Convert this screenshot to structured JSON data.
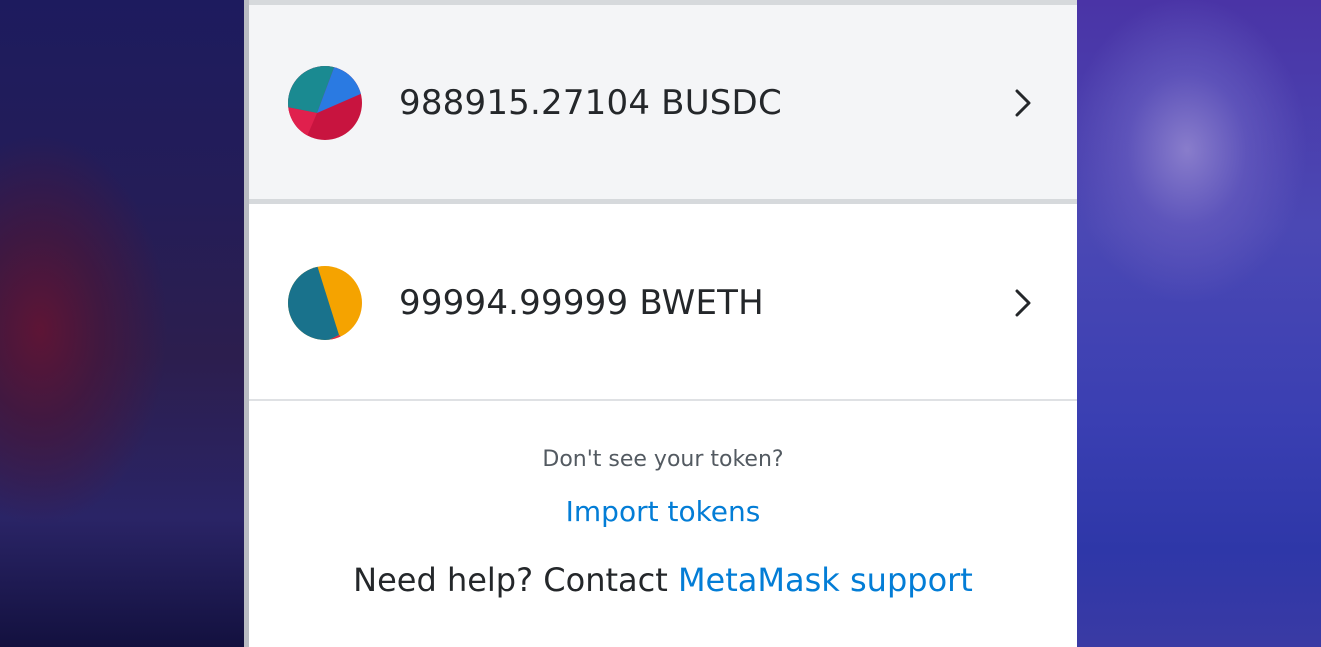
{
  "assets": [
    {
      "amount_label": "988915.27104 BUSDC",
      "icon": "busdc-token-icon",
      "icon_colors": [
        "#c8143f",
        "#1a8a91",
        "#2a7ae2"
      ]
    },
    {
      "amount_label": "99994.99999 BWETH",
      "icon": "bweth-token-icon",
      "icon_colors": [
        "#f5a300",
        "#19728c",
        "#e22748"
      ]
    }
  ],
  "help": {
    "prompt": "Don't see your token?",
    "import_label": "Import tokens",
    "need_help_prefix": "Need help? Contact ",
    "support_label": "MetaMask support"
  },
  "colors": {
    "link": "#037dd6",
    "text": "#24272a",
    "muted": "#535a61",
    "hover_row": "#f4f5f7"
  }
}
